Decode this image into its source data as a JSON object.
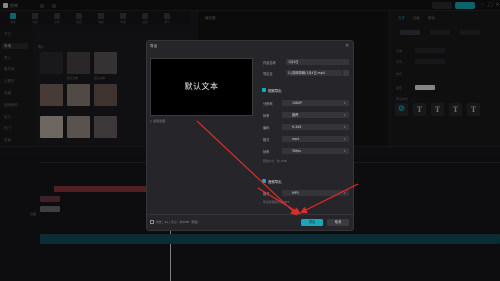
{
  "app": {
    "name": "剪映",
    "logo_icon": "capcut-logo-icon"
  },
  "topbar": {
    "export_label": "导出",
    "pro_label": "专业版"
  },
  "media_toolbar": [
    "媒体",
    "音频",
    "文本",
    "贴纸",
    "特效",
    "转场",
    "滤镜",
    "调节"
  ],
  "sidebar": {
    "items": [
      "本地",
      "导入",
      "素材库",
      "云素材",
      "收藏",
      "品牌素材",
      "官方",
      "热门",
      "节日",
      "背景"
    ]
  },
  "media": {
    "section_label": "导入",
    "items": [
      "默认文本",
      "默认文本",
      "默认文本",
      "默认文本",
      "默认文本",
      "默认文本",
      "默认文本",
      "默认文本",
      "默认文本"
    ]
  },
  "player": {
    "title": "播放器"
  },
  "right_panel": {
    "tabs": [
      "文本",
      "动画",
      "朗读"
    ],
    "sub_tabs": [
      "基础",
      "花字",
      "气泡"
    ],
    "labels": [
      "字体",
      "字号",
      "样式",
      "颜色",
      "预设样式"
    ]
  },
  "dialog": {
    "title": "导出",
    "close_icon": "close-icon",
    "preview_text": "默认文本",
    "cover_hint": "▷ 编辑封面",
    "name_label": "作品名称",
    "name_value": "1月4日",
    "path_label": "导出至",
    "path_value": "C:/剪映草稿/1月4日.mp4",
    "video_section": "视频导出",
    "fields": [
      {
        "label": "分辨率",
        "value": "1080P"
      },
      {
        "label": "码率",
        "value": "推荐"
      },
      {
        "label": "编码",
        "value": "H.264"
      },
      {
        "label": "格式",
        "value": "mp4"
      },
      {
        "label": "帧率",
        "value": "30fps"
      }
    ],
    "video_hint": "预估大小：约 1MB",
    "audio_section": "音频导出",
    "audio_field": {
      "label": "格式",
      "value": "MP3"
    },
    "audio_hint": "导出音频格式为 MP3",
    "footer_info": "时长：4s  |  大小：约1MB（预估）",
    "export_button": "导出",
    "cancel_button": "取消"
  },
  "colors": {
    "accent": "#1aa7b8",
    "arrow": "#e02b2b"
  }
}
